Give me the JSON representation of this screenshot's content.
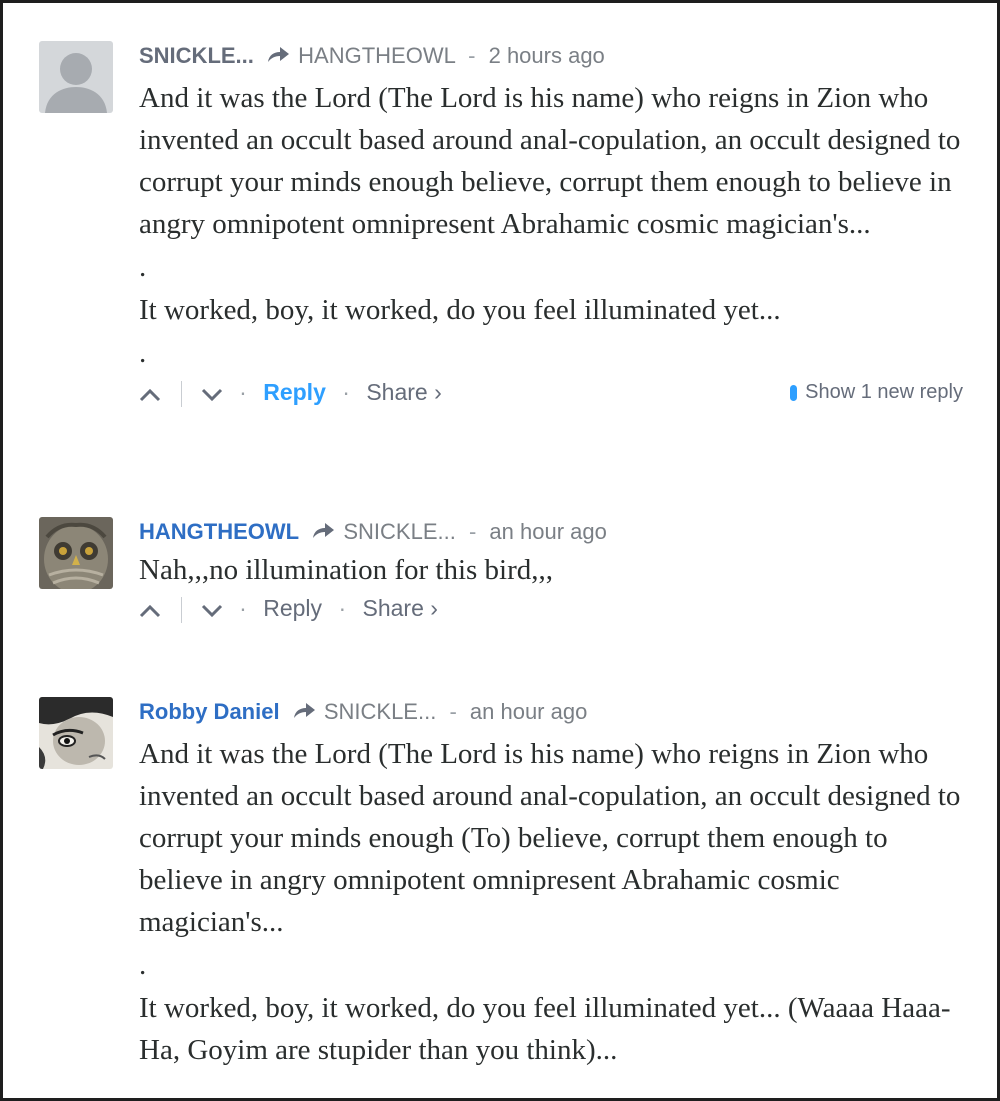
{
  "comments": [
    {
      "author": "SNICKLE...",
      "reply_to": "HANGTHEOWL",
      "time": "2 hours ago",
      "paragraphs": [
        "And it was the Lord (The Lord is his name) who reigns in Zion who invented an occult based around anal-copulation, an occult designed to corrupt your minds enough believe, corrupt them enough to believe in angry omnipotent omnipresent Abrahamic cosmic magician's...",
        ".",
        "It worked, boy, it worked, do you feel illuminated yet...",
        "."
      ],
      "reply_label": "Reply",
      "share_label": "Share ›",
      "new_reply_label": "Show 1 new reply"
    },
    {
      "author": "HANGTHEOWL",
      "reply_to": "SNICKLE...",
      "time": "an hour ago",
      "paragraphs": [
        "Nah,,,no illumination for this bird,,,"
      ],
      "reply_label": "Reply",
      "share_label": "Share ›"
    },
    {
      "author": "Robby Daniel",
      "reply_to": "SNICKLE...",
      "time": "an hour ago",
      "paragraphs": [
        "And it was the Lord (The Lord is his name) who reigns in Zion who invented an occult based around anal-copulation, an occult designed to corrupt your minds enough (To) believe, corrupt them enough to believe in angry omnipotent omnipresent Abrahamic cosmic magician's...",
        ".",
        "It worked, boy, it worked, do you feel illuminated yet... (Waaaa Haaa-Ha, Goyim are stupider than you think)..."
      ]
    }
  ],
  "colors": {
    "link_blue": "#2e6ec4",
    "reply_blue": "#2e9fff",
    "meta_gray": "#7a7f85",
    "text": "#2a2e2e"
  }
}
